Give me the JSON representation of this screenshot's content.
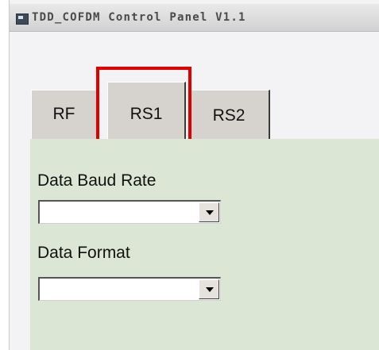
{
  "window": {
    "title": "TDD_COFDM Control Panel V1.1",
    "icon": "app-window-icon"
  },
  "tabs": [
    {
      "label": "RF",
      "selected": false
    },
    {
      "label": "RS1",
      "selected": true
    },
    {
      "label": "RS2",
      "selected": false
    }
  ],
  "highlight_color": "#e00000",
  "panel_color": "#dbe7d4",
  "form": {
    "baud_rate_label": "Data Baud Rate",
    "baud_rate_value": "",
    "format_label": "Data Format",
    "format_value": ""
  }
}
